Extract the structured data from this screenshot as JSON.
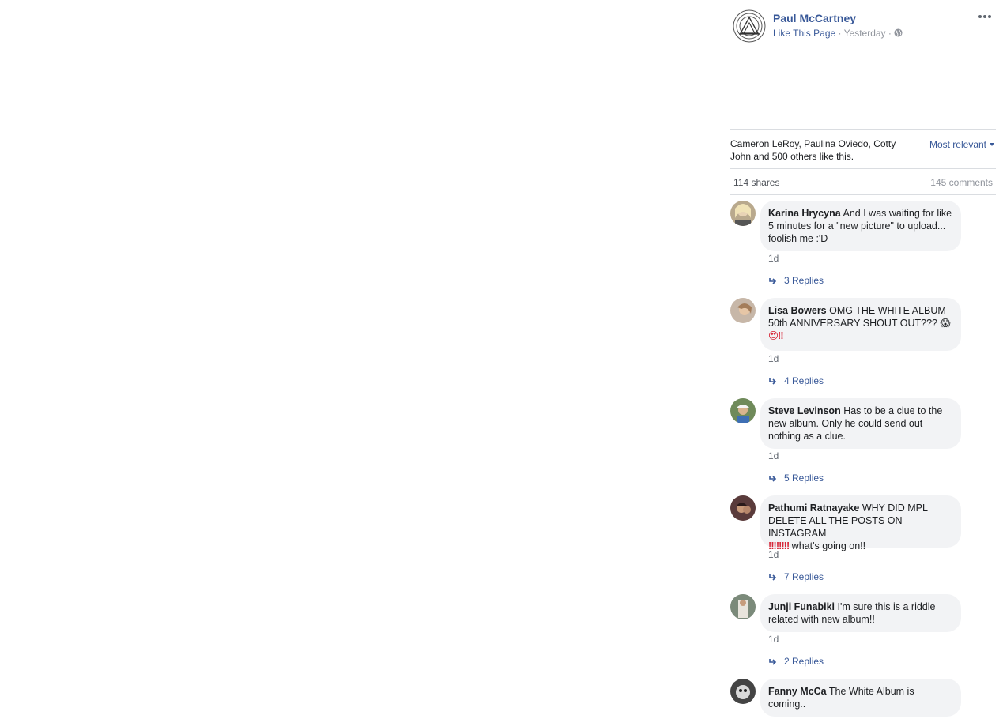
{
  "post": {
    "page_name": "Paul McCartney",
    "like_link": "Like This Page",
    "separator": " · ",
    "time": "Yesterday",
    "privacy_icon": "globe-icon",
    "more_icon": "more-options-icon"
  },
  "likes": {
    "text": "Cameron LeRoy, Paulina Oviedo, Cotty John and 500 others like this.",
    "sort_label": "Most relevant"
  },
  "counts": {
    "shares": "114 shares",
    "comments": "145 comments"
  },
  "comments": [
    {
      "author": "Karina Hrycyna",
      "text": "And I was waiting for like 5 minutes for a \"new picture\" to upload... foolish me :'D",
      "time": "1d",
      "replies": "3 Replies"
    },
    {
      "author": "Lisa Bowers",
      "text": "OMG THE WHITE ALBUM 50th ANNIVERSARY SHOUT OUT??? 😱",
      "text_line2": "😍‼",
      "time": "1d",
      "replies": "4 Replies"
    },
    {
      "author": "Steve Levinson",
      "text": "Has to be a clue to the new album. Only he could send out nothing as a clue.",
      "time": "1d",
      "replies": "5 Replies"
    },
    {
      "author": "Pathumi Ratnayake",
      "text": "WHY DID MPL DELETE ALL THE POSTS ON INSTAGRAM",
      "text_emoji": "‼‼‼‼",
      "text_tail": " what's going on!!",
      "time": "1d",
      "replies": "7 Replies"
    },
    {
      "author": "Junji Funabiki",
      "text": "I'm sure this is a riddle related with new album!!",
      "time": "1d",
      "replies": "2 Replies"
    },
    {
      "author": "Fanny McCa",
      "text": "The White Album is coming.."
    }
  ],
  "colors": {
    "link": "#385898",
    "bubble": "#f2f3f5",
    "muted": "#90949c",
    "divider": "#dadde1"
  }
}
